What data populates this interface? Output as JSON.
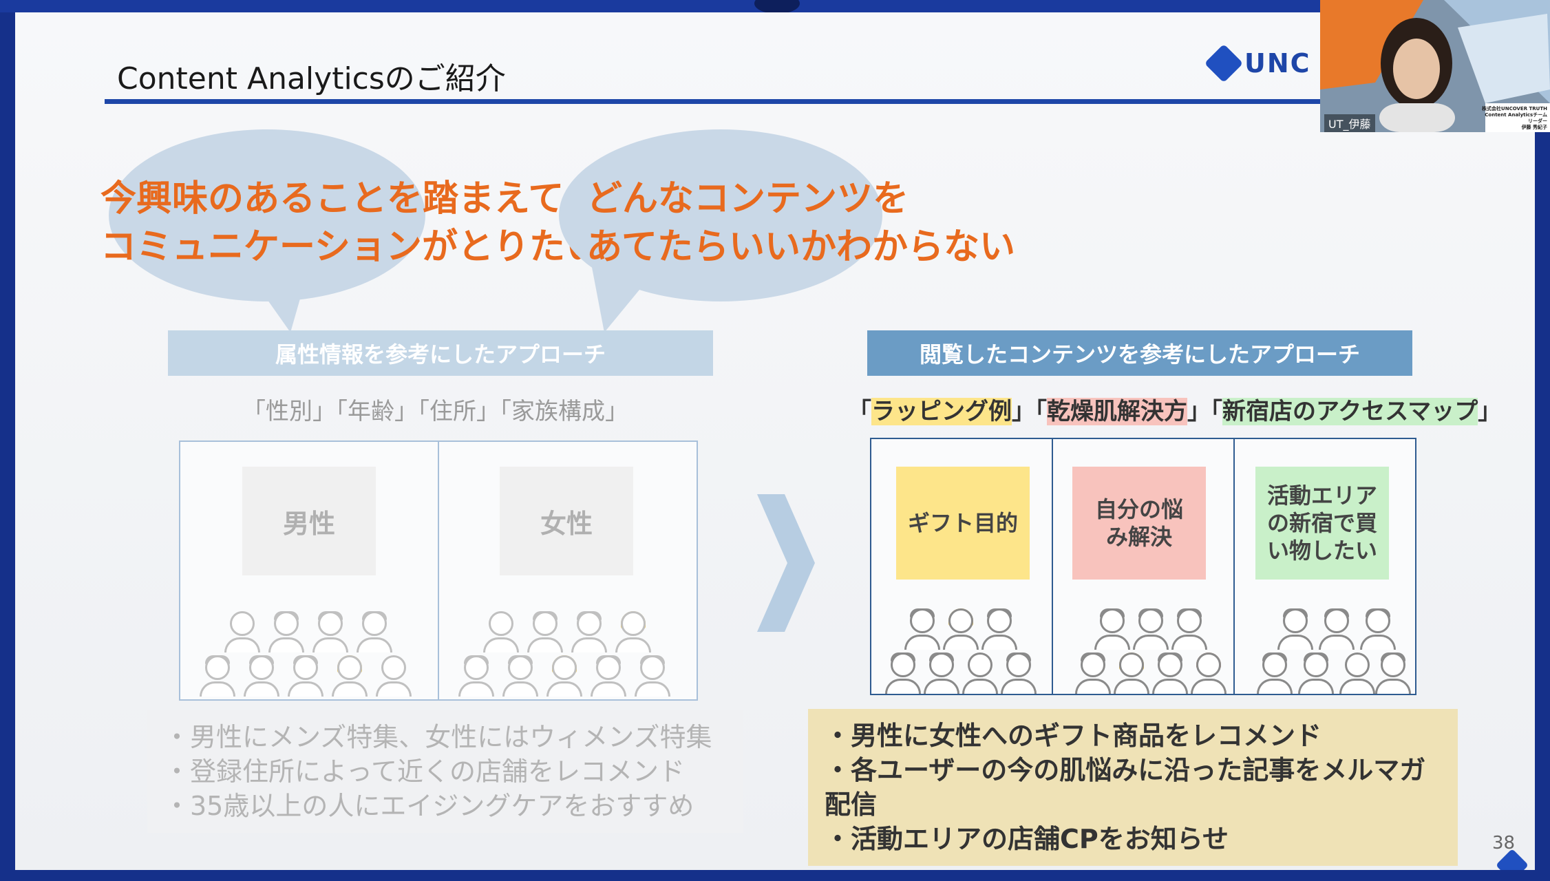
{
  "slide": {
    "title": "Content Analyticsのご紹介",
    "logo_text": "UNC",
    "page_number": "38"
  },
  "bubbles": {
    "left": [
      "今興味のあることを踏まえて",
      "コミュニケーションがとりたい"
    ],
    "right": [
      "どんなコンテンツを",
      "あてたらいいかわからない"
    ]
  },
  "left": {
    "header": "属性情報を参考にしたアプローチ",
    "attributes": "「性別」「年齢」「住所」「家族構成」",
    "groups": [
      "男性",
      "女性"
    ],
    "bullets": [
      "・男性にメンズ特集、女性にはウィメンズ特集",
      "・登録住所によって近くの店舗をレコメンド",
      "・35歳以上の人にエイジングケアをおすすめ"
    ]
  },
  "right": {
    "header": "閲覧したコンテンツを参考にしたアプローチ",
    "content_bracket_open": "「",
    "content_sep": "」「",
    "content_bracket_close": "」",
    "contents": [
      "ラッピング例",
      "乾燥肌解決方",
      "新宿店のアクセスマップ"
    ],
    "groups": [
      "ギフト目的",
      "自分の悩み解決",
      "活動エリアの新宿で買い物したい"
    ],
    "bullets": [
      "・男性に女性へのギフト商品をレコメンド",
      "・各ユーザーの今の肌悩みに沿った記事をメルマガ配信",
      "・活動エリアの店舗CPをお知らせ"
    ]
  },
  "webcam": {
    "name_label": "UT_伊藤",
    "company_line1": "株式会社UNCOVER TRUTH",
    "company_line2": "Content Analyticsチーム",
    "company_line3": "リーダー",
    "company_line4": "伊藤 秀紀子"
  },
  "colors": {
    "accent_blue": "#1e46a8",
    "bubble_text": "#e86a1e",
    "header_left": "#c3d6e6",
    "header_right": "#6b9cc5",
    "sticky_yellow": "#fde58a",
    "sticky_pink": "#f8c3bd",
    "sticky_green": "#c9f0c9",
    "bullet_box_right": "#efe2b6"
  }
}
